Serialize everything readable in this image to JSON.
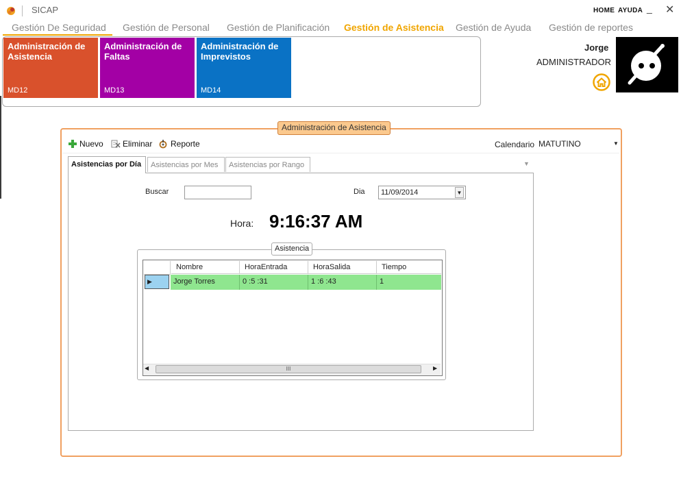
{
  "window": {
    "app_title": "SICAP",
    "home_link": "HOME",
    "help_link": "AYUDA",
    "minimize_glyph": "_",
    "close_glyph": "✕"
  },
  "menu": {
    "items": [
      {
        "label": "Gestión De Seguridad"
      },
      {
        "label": "Gestión de Personal"
      },
      {
        "label": "Gestión de Planificación"
      },
      {
        "label": "Gestión de Asistencia"
      },
      {
        "label": "Gestión de Ayuda"
      },
      {
        "label": "Gestión de reportes"
      }
    ],
    "active_index": 3
  },
  "tiles": [
    {
      "title": "Administración de Asistencia",
      "code": "MD12",
      "color": "#d9512c"
    },
    {
      "title": "Administración de Faltas",
      "code": "MD13",
      "color": "#a300a5"
    },
    {
      "title": "Administración de Imprevistos",
      "code": "MD14",
      "color": "#0a72c5"
    }
  ],
  "user": {
    "name": "Jorge",
    "role": "ADMINISTRADOR",
    "home_icon": "home-icon",
    "avatar_icon": "avatar-icon"
  },
  "panel": {
    "title": "Administración de Asistencia",
    "toolbar": {
      "new_label": "Nuevo",
      "delete_label": "Eliminar",
      "report_label": "Reporte",
      "calendar_label": "Calendario",
      "calendar_value": "MATUTINO"
    },
    "tabs": [
      {
        "label": "Asistencias por Día"
      },
      {
        "label": "Asistencias por Mes"
      },
      {
        "label": "Asistencias por Rango"
      }
    ],
    "form": {
      "search_label": "Buscar",
      "search_value": "",
      "day_label": "Dia",
      "day_value": "11/09/2014",
      "time_label": "Hora:",
      "time_value": "9:16:37 AM"
    },
    "grid": {
      "group_title": "Asistencia",
      "columns": [
        "Nombre",
        "HoraEntrada",
        "HoraSalida",
        "Tiempo"
      ],
      "rows": [
        {
          "nombre": "Jorge Torres",
          "hora_entrada": "0 :5 :31",
          "hora_salida": "1 :6 :43",
          "tiempo": "1"
        }
      ],
      "scroll_thumb_label": "III"
    }
  },
  "colors": {
    "accent": "#f0a500",
    "panel_border": "#f0a060",
    "row_highlight": "#8fe68f"
  }
}
